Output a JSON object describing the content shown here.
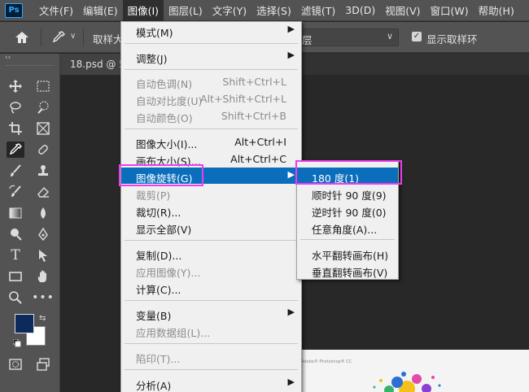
{
  "menubar": {
    "logo": "Ps",
    "items": [
      "文件(F)",
      "编辑(E)",
      "图像(I)",
      "图层(L)",
      "文字(Y)",
      "选择(S)",
      "滤镜(T)",
      "3D(D)",
      "视图(V)",
      "窗口(W)",
      "帮助(H)"
    ],
    "active_index": 2
  },
  "options_bar": {
    "sample_size_label": "取样大",
    "sample_layer_value": "层",
    "show_ring_label": "显示取样环",
    "show_ring_checked": true
  },
  "toolbar": {
    "collapse_glyph": "‹‹",
    "foreground_color": "#0d2a5c",
    "background_color": "#ffffff",
    "selected_tool": "eyedropper-tool"
  },
  "document": {
    "tab_label": "18.psd @ 5",
    "caption": "Adobe® Photoshop® CC"
  },
  "image_menu": {
    "items": [
      {
        "label": "模式(M)",
        "shortcut": "",
        "submenu": true,
        "disabled": false
      },
      {
        "label": "调整(J)",
        "shortcut": "",
        "submenu": true,
        "disabled": false
      },
      {
        "label": "自动色调(N)",
        "shortcut": "Shift+Ctrl+L",
        "submenu": false,
        "disabled": true
      },
      {
        "label": "自动对比度(U)",
        "shortcut": "Alt+Shift+Ctrl+L",
        "submenu": false,
        "disabled": true
      },
      {
        "label": "自动颜色(O)",
        "shortcut": "Shift+Ctrl+B",
        "submenu": false,
        "disabled": true
      },
      {
        "label": "图像大小(I)...",
        "shortcut": "Alt+Ctrl+I",
        "submenu": false,
        "disabled": false
      },
      {
        "label": "画布大小(S)...",
        "shortcut": "Alt+Ctrl+C",
        "submenu": false,
        "disabled": false
      },
      {
        "label": "图像旋转(G)",
        "shortcut": "",
        "submenu": true,
        "disabled": false,
        "highlighted": true
      },
      {
        "label": "裁剪(P)",
        "shortcut": "",
        "submenu": false,
        "disabled": true
      },
      {
        "label": "裁切(R)...",
        "shortcut": "",
        "submenu": false,
        "disabled": false
      },
      {
        "label": "显示全部(V)",
        "shortcut": "",
        "submenu": false,
        "disabled": false
      },
      {
        "label": "复制(D)...",
        "shortcut": "",
        "submenu": false,
        "disabled": false
      },
      {
        "label": "应用图像(Y)...",
        "shortcut": "",
        "submenu": false,
        "disabled": true
      },
      {
        "label": "计算(C)...",
        "shortcut": "",
        "submenu": false,
        "disabled": false
      },
      {
        "label": "变量(B)",
        "shortcut": "",
        "submenu": true,
        "disabled": false
      },
      {
        "label": "应用数据组(L)...",
        "shortcut": "",
        "submenu": false,
        "disabled": true
      },
      {
        "label": "陷印(T)...",
        "shortcut": "",
        "submenu": false,
        "disabled": true
      },
      {
        "label": "分析(A)",
        "shortcut": "",
        "submenu": true,
        "disabled": false
      }
    ]
  },
  "rotate_menu": {
    "items": [
      {
        "label": "180 度(1)",
        "highlighted": true
      },
      {
        "label": "顺时针 90 度(9)",
        "highlighted": false
      },
      {
        "label": "逆时针 90 度(0)",
        "highlighted": false
      },
      {
        "label": "任意角度(A)...",
        "highlighted": false
      },
      {
        "label": "水平翻转画布(H)",
        "highlighted": false
      },
      {
        "label": "垂直翻转画布(V)",
        "highlighted": false
      }
    ]
  },
  "colors": {
    "menu_highlight": "#0a6ebd",
    "annotation_box": "#ee3cf0"
  }
}
